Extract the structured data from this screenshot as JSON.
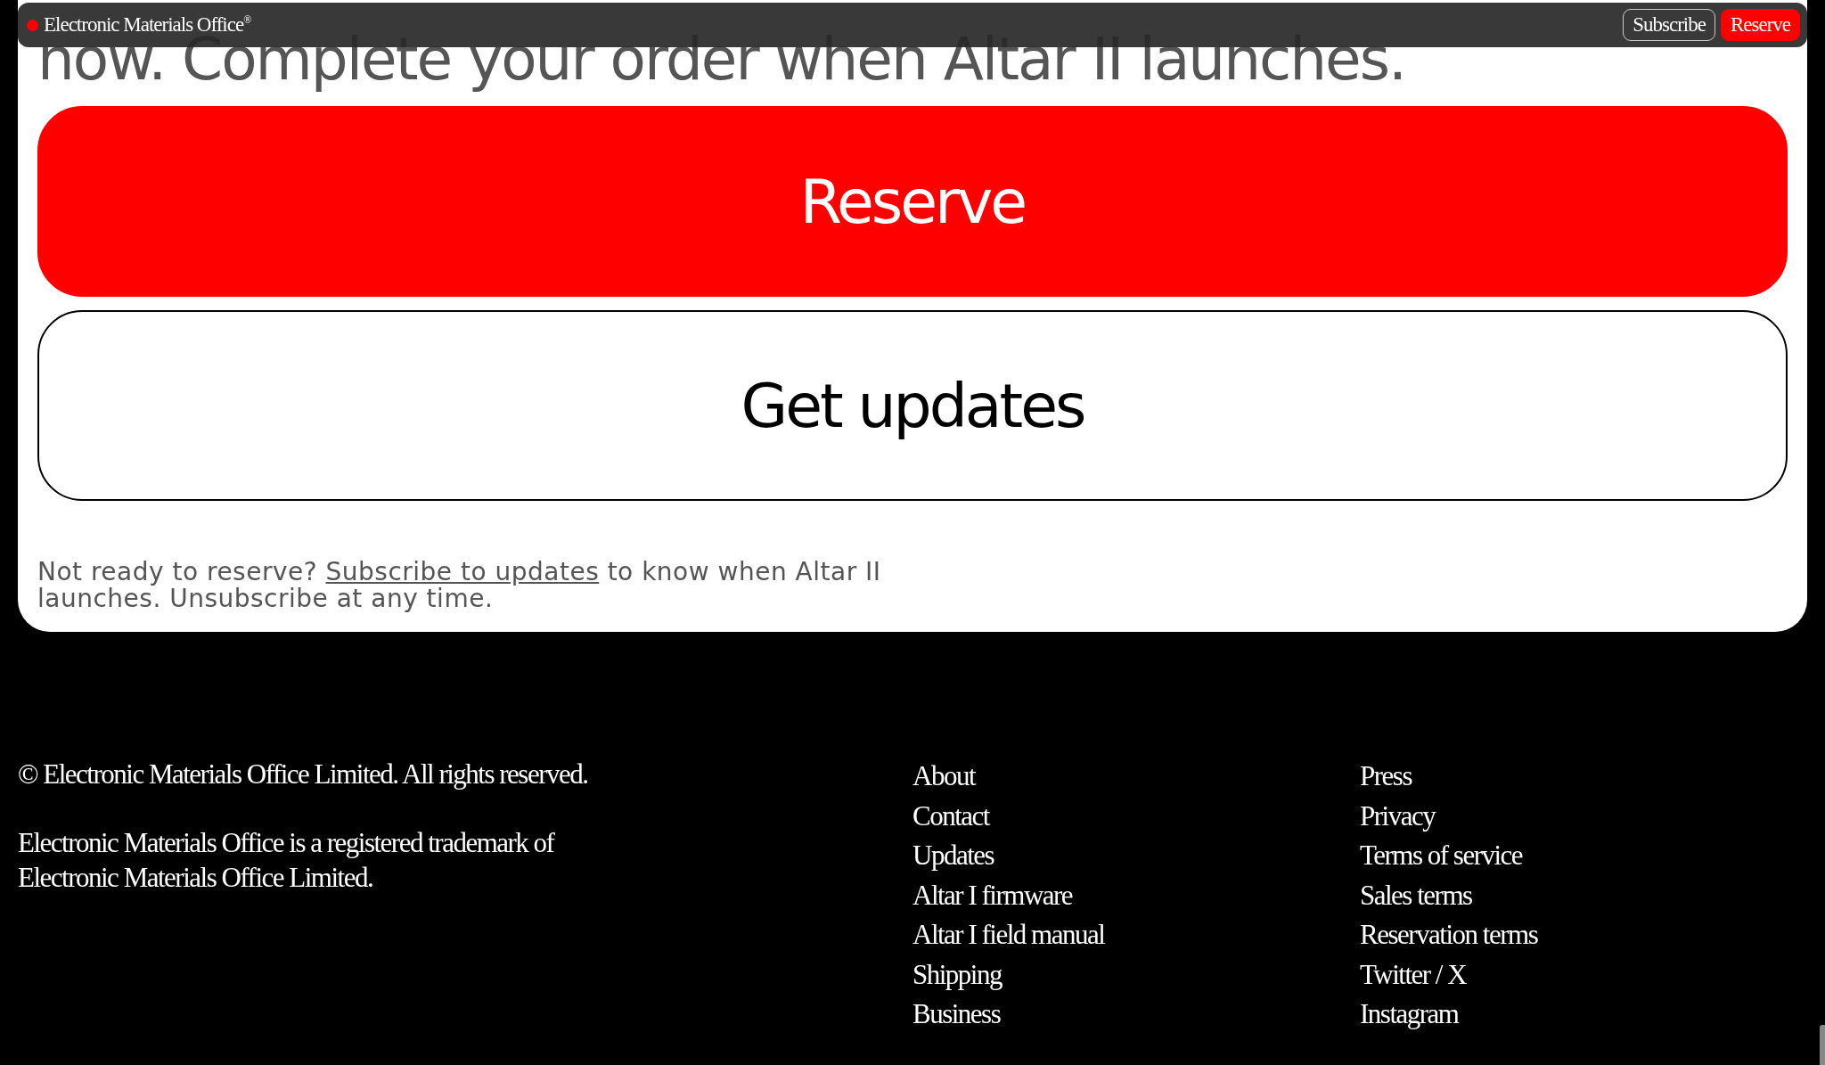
{
  "nav": {
    "brand": "Electronic Materials Office$^{®}$",
    "buttons": [
      {
        "label": "Subscribe",
        "kind": "outline"
      },
      {
        "label": "Reserve",
        "kind": "primary"
      }
    ]
  },
  "heading": "now. Complete your order when Altar II launches.",
  "actions": [
    {
      "label": "Reserve",
      "kind": "primary"
    },
    {
      "label": "Get updates",
      "kind": "outline"
    }
  ],
  "note": {
    "before": "Not ready to reserve? ",
    "link": "Subscribe to updates",
    "after": " to know when Altar II launches. Unsubscribe at any time."
  },
  "footer": {
    "copyright": "© Electronic Materials Office Limited. All rights reserved.",
    "trademark": "Electronic Materials Office is a registered trademark of Electronic Materials Office Limited.",
    "columns": [
      [
        "About",
        "Contact",
        "Updates",
        "Altar I firmware",
        "Altar I field manual",
        "Shipping",
        "Business"
      ],
      [
        "Press",
        "Privacy",
        "Terms of service",
        "Sales terms",
        "Reservation terms",
        "Twitter / X",
        "Instagram"
      ]
    ]
  }
}
